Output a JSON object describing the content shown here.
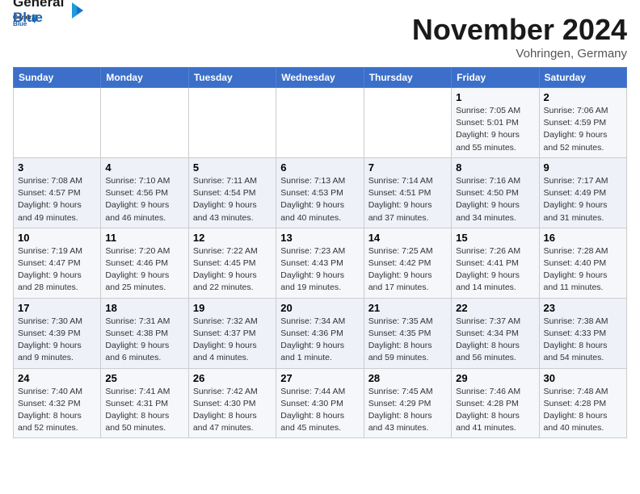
{
  "logo": {
    "line1": "General",
    "line2": "Blue"
  },
  "title": "November 2024",
  "location": "Vohringen, Germany",
  "weekdays": [
    "Sunday",
    "Monday",
    "Tuesday",
    "Wednesday",
    "Thursday",
    "Friday",
    "Saturday"
  ],
  "weeks": [
    [
      {
        "day": "",
        "info": ""
      },
      {
        "day": "",
        "info": ""
      },
      {
        "day": "",
        "info": ""
      },
      {
        "day": "",
        "info": ""
      },
      {
        "day": "",
        "info": ""
      },
      {
        "day": "1",
        "info": "Sunrise: 7:05 AM\nSunset: 5:01 PM\nDaylight: 9 hours and 55 minutes."
      },
      {
        "day": "2",
        "info": "Sunrise: 7:06 AM\nSunset: 4:59 PM\nDaylight: 9 hours and 52 minutes."
      }
    ],
    [
      {
        "day": "3",
        "info": "Sunrise: 7:08 AM\nSunset: 4:57 PM\nDaylight: 9 hours and 49 minutes."
      },
      {
        "day": "4",
        "info": "Sunrise: 7:10 AM\nSunset: 4:56 PM\nDaylight: 9 hours and 46 minutes."
      },
      {
        "day": "5",
        "info": "Sunrise: 7:11 AM\nSunset: 4:54 PM\nDaylight: 9 hours and 43 minutes."
      },
      {
        "day": "6",
        "info": "Sunrise: 7:13 AM\nSunset: 4:53 PM\nDaylight: 9 hours and 40 minutes."
      },
      {
        "day": "7",
        "info": "Sunrise: 7:14 AM\nSunset: 4:51 PM\nDaylight: 9 hours and 37 minutes."
      },
      {
        "day": "8",
        "info": "Sunrise: 7:16 AM\nSunset: 4:50 PM\nDaylight: 9 hours and 34 minutes."
      },
      {
        "day": "9",
        "info": "Sunrise: 7:17 AM\nSunset: 4:49 PM\nDaylight: 9 hours and 31 minutes."
      }
    ],
    [
      {
        "day": "10",
        "info": "Sunrise: 7:19 AM\nSunset: 4:47 PM\nDaylight: 9 hours and 28 minutes."
      },
      {
        "day": "11",
        "info": "Sunrise: 7:20 AM\nSunset: 4:46 PM\nDaylight: 9 hours and 25 minutes."
      },
      {
        "day": "12",
        "info": "Sunrise: 7:22 AM\nSunset: 4:45 PM\nDaylight: 9 hours and 22 minutes."
      },
      {
        "day": "13",
        "info": "Sunrise: 7:23 AM\nSunset: 4:43 PM\nDaylight: 9 hours and 19 minutes."
      },
      {
        "day": "14",
        "info": "Sunrise: 7:25 AM\nSunset: 4:42 PM\nDaylight: 9 hours and 17 minutes."
      },
      {
        "day": "15",
        "info": "Sunrise: 7:26 AM\nSunset: 4:41 PM\nDaylight: 9 hours and 14 minutes."
      },
      {
        "day": "16",
        "info": "Sunrise: 7:28 AM\nSunset: 4:40 PM\nDaylight: 9 hours and 11 minutes."
      }
    ],
    [
      {
        "day": "17",
        "info": "Sunrise: 7:30 AM\nSunset: 4:39 PM\nDaylight: 9 hours and 9 minutes."
      },
      {
        "day": "18",
        "info": "Sunrise: 7:31 AM\nSunset: 4:38 PM\nDaylight: 9 hours and 6 minutes."
      },
      {
        "day": "19",
        "info": "Sunrise: 7:32 AM\nSunset: 4:37 PM\nDaylight: 9 hours and 4 minutes."
      },
      {
        "day": "20",
        "info": "Sunrise: 7:34 AM\nSunset: 4:36 PM\nDaylight: 9 hours and 1 minute."
      },
      {
        "day": "21",
        "info": "Sunrise: 7:35 AM\nSunset: 4:35 PM\nDaylight: 8 hours and 59 minutes."
      },
      {
        "day": "22",
        "info": "Sunrise: 7:37 AM\nSunset: 4:34 PM\nDaylight: 8 hours and 56 minutes."
      },
      {
        "day": "23",
        "info": "Sunrise: 7:38 AM\nSunset: 4:33 PM\nDaylight: 8 hours and 54 minutes."
      }
    ],
    [
      {
        "day": "24",
        "info": "Sunrise: 7:40 AM\nSunset: 4:32 PM\nDaylight: 8 hours and 52 minutes."
      },
      {
        "day": "25",
        "info": "Sunrise: 7:41 AM\nSunset: 4:31 PM\nDaylight: 8 hours and 50 minutes."
      },
      {
        "day": "26",
        "info": "Sunrise: 7:42 AM\nSunset: 4:30 PM\nDaylight: 8 hours and 47 minutes."
      },
      {
        "day": "27",
        "info": "Sunrise: 7:44 AM\nSunset: 4:30 PM\nDaylight: 8 hours and 45 minutes."
      },
      {
        "day": "28",
        "info": "Sunrise: 7:45 AM\nSunset: 4:29 PM\nDaylight: 8 hours and 43 minutes."
      },
      {
        "day": "29",
        "info": "Sunrise: 7:46 AM\nSunset: 4:28 PM\nDaylight: 8 hours and 41 minutes."
      },
      {
        "day": "30",
        "info": "Sunrise: 7:48 AM\nSunset: 4:28 PM\nDaylight: 8 hours and 40 minutes."
      }
    ]
  ]
}
